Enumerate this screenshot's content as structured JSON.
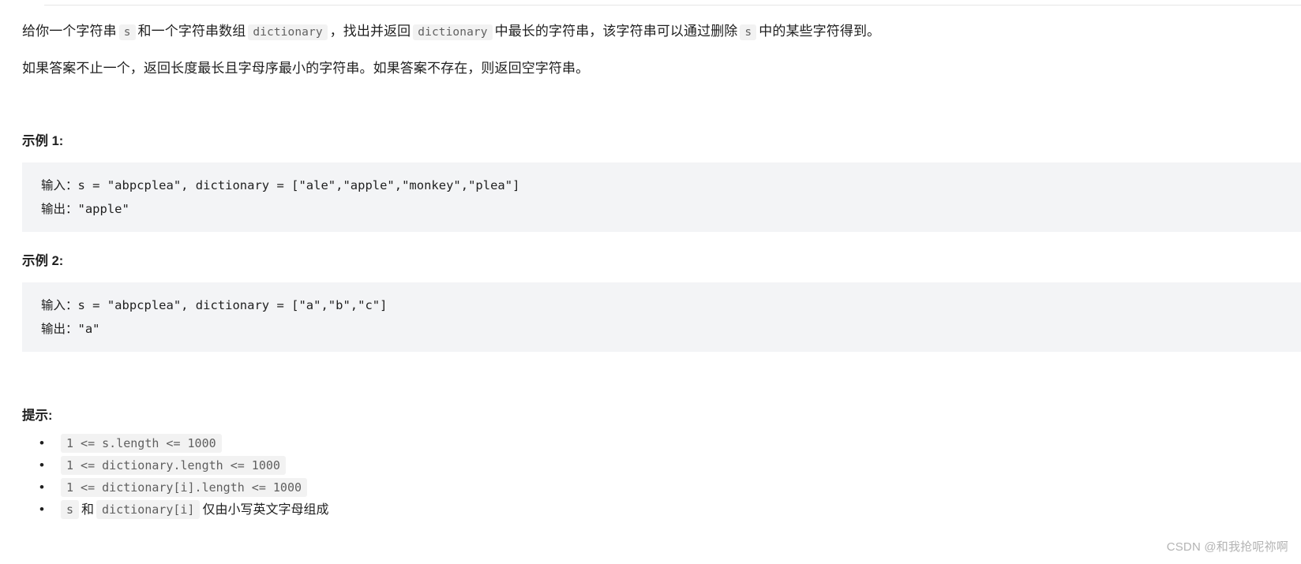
{
  "problem": {
    "description_line_1": {
      "seg_1": "给你一个字符串",
      "code_1": "s",
      "seg_2": "和一个字符串数组",
      "code_2": "dictionary",
      "seg_3": "，找出并返回",
      "code_3": "dictionary",
      "seg_4": "中最长的字符串，该字符串可以通过删除",
      "code_4": "s",
      "seg_5": "中的某些字符得到。"
    },
    "description_line_2": "如果答案不止一个，返回长度最长且字母序最小的字符串。如果答案不存在，则返回空字符串。"
  },
  "examples": [
    {
      "title": "示例 1:",
      "code": "输入：s = \"abpcplea\", dictionary = [\"ale\",\"apple\",\"monkey\",\"plea\"]\n输出：\"apple\""
    },
    {
      "title": "示例 2:",
      "code": "输入：s = \"abpcplea\", dictionary = [\"a\",\"b\",\"c\"]\n输出：\"a\""
    }
  ],
  "hints": {
    "title": "提示:",
    "items": [
      {
        "type": "code",
        "code": "1 <= s.length <= 1000"
      },
      {
        "type": "code",
        "code": "1 <= dictionary.length <= 1000"
      },
      {
        "type": "code",
        "code": "1 <= dictionary[i].length <= 1000"
      },
      {
        "type": "mixed",
        "code_a": "s",
        "text_a": "和",
        "code_b": "dictionary[i]",
        "text_b": "仅由小写英文字母组成"
      }
    ]
  },
  "watermark": "CSDN @和我抢呢祢啊"
}
